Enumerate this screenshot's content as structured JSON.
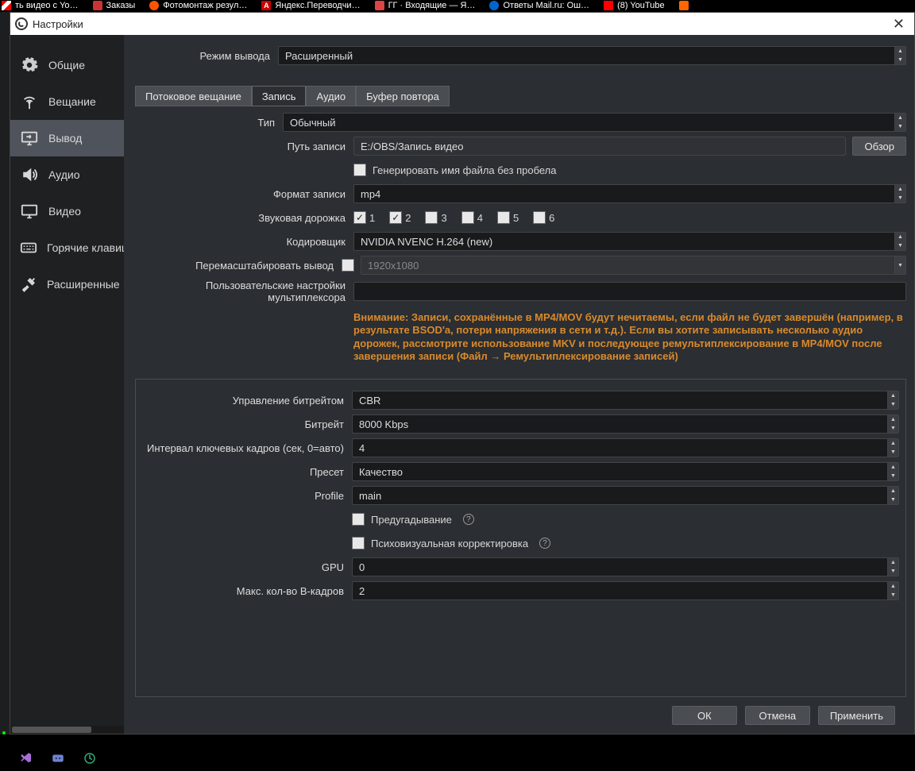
{
  "browser_tabs": [
    {
      "label": "ть видео с Yo…"
    },
    {
      "label": "Заказы"
    },
    {
      "label": "Фотомонтаж резул…"
    },
    {
      "label": "Яндекс.Переводчи…",
      "fA": "А"
    },
    {
      "label": "ГГ · Входящие — Я…"
    },
    {
      "label": "Ответы Mail.ru: Ош…"
    },
    {
      "label": "(8) YouTube"
    }
  ],
  "window_title": "Настройки",
  "sidebar": {
    "items": [
      {
        "label": "Общие"
      },
      {
        "label": "Вещание"
      },
      {
        "label": "Вывод"
      },
      {
        "label": "Аудио"
      },
      {
        "label": "Видео"
      },
      {
        "label": "Горячие клавиши"
      },
      {
        "label": "Расширенные"
      }
    ]
  },
  "top": {
    "output_mode_label": "Режим вывода",
    "output_mode_value": "Расширенный"
  },
  "tabs": [
    {
      "label": "Потоковое вещание"
    },
    {
      "label": "Запись"
    },
    {
      "label": "Аудио"
    },
    {
      "label": "Буфер повтора"
    }
  ],
  "rec": {
    "type_label": "Тип",
    "type_value": "Обычный",
    "path_label": "Путь записи",
    "path_value": "E:/OBS/Запись видео",
    "browse": "Обзор",
    "gen_no_space": "Генерировать имя файла без пробела",
    "format_label": "Формат записи",
    "format_value": "mp4",
    "tracks_label": "Звуковая дорожка",
    "tracks": [
      "1",
      "2",
      "3",
      "4",
      "5",
      "6"
    ],
    "encoder_label": "Кодировщик",
    "encoder_value": "NVIDIA NVENC H.264 (new)",
    "rescale_label": "Перемасштабировать вывод",
    "rescale_value": "1920x1080",
    "mux_label": "Пользовательские настройки мультиплексора",
    "warning": "Внимание: Записи, сохранённые в MP4/MOV будут нечитаемы, если файл не будет завершён (например, в результате BSOD'а, потери напряжения в сети и т.д.). Если вы хотите записывать несколько аудио дорожек, рассмотрите использование MKV и последующее ремультиплексирование в MP4/MOV после завершения записи (Файл → Ремультиплексирование записей)"
  },
  "enc": {
    "rate_control_label": "Управление битрейтом",
    "rate_control_value": "CBR",
    "bitrate_label": "Битрейт",
    "bitrate_value": "8000 Kbps",
    "keyint_label": "Интервал ключевых кадров (сек, 0=авто)",
    "keyint_value": "4",
    "preset_label": "Пресет",
    "preset_value": "Качество",
    "profile_label": "Profile",
    "profile_value": "main",
    "lookahead": "Предугадывание",
    "psycho": "Психовизуальная корректировка",
    "gpu_label": "GPU",
    "gpu_value": "0",
    "bframes_label": "Макс. кол-во B-кадров",
    "bframes_value": "2"
  },
  "buttons": {
    "ok": "ОК",
    "cancel": "Отмена",
    "apply": "Применить"
  }
}
